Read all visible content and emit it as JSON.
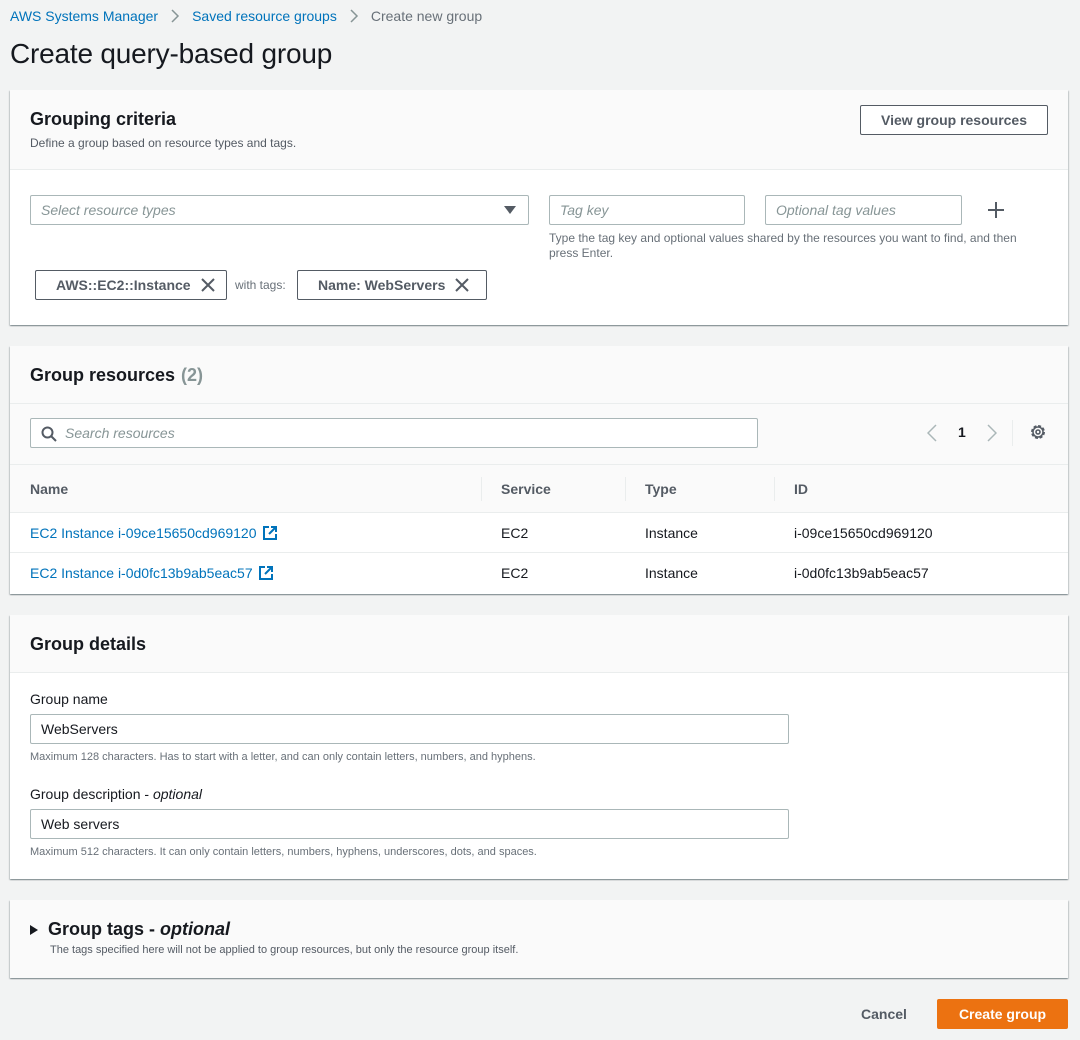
{
  "breadcrumb": {
    "items": [
      {
        "label": "AWS Systems Manager"
      },
      {
        "label": "Saved resource groups"
      },
      {
        "label": "Create new group"
      }
    ]
  },
  "page": {
    "title": "Create query-based group"
  },
  "grouping_criteria": {
    "title": "Grouping criteria",
    "description": "Define a group based on resource types and tags.",
    "view_button": "View group resources",
    "resource_types_placeholder": "Select resource types",
    "tag_key_placeholder": "Tag key",
    "tag_values_placeholder": "Optional tag values",
    "tag_hint": "Type the tag key and optional values shared by the resources you want to find, and then press Enter.",
    "resource_token": "AWS::EC2::Instance",
    "with_tags_label": "with tags:",
    "tag_token": "Name: WebServers"
  },
  "group_resources": {
    "title": "Group resources",
    "count": "(2)",
    "search_placeholder": "Search resources",
    "pagination": {
      "current_page": "1"
    },
    "columns": [
      "Name",
      "Service",
      "Type",
      "ID"
    ],
    "rows": [
      {
        "name": "EC2 Instance i-09ce15650cd969120",
        "service": "EC2",
        "type": "Instance",
        "id": "i-09ce15650cd969120"
      },
      {
        "name": "EC2 Instance i-0d0fc13b9ab5eac57",
        "service": "EC2",
        "type": "Instance",
        "id": "i-0d0fc13b9ab5eac57"
      }
    ]
  },
  "group_details": {
    "title": "Group details",
    "name_label": "Group name",
    "name_value": "WebServers",
    "name_hint": "Maximum 128 characters. Has to start with a letter, and can only contain letters, numbers, and hyphens.",
    "description_label": "Group description",
    "description_optional": "optional",
    "description_value": "Web servers",
    "description_hint": "Maximum 512 characters. It can only contain letters, numbers, hyphens, underscores, dots, and spaces."
  },
  "group_tags": {
    "title": "Group tags",
    "optional": "optional",
    "description": "The tags specified here will not be applied to group resources, but only the resource group itself."
  },
  "footer": {
    "cancel_label": "Cancel",
    "create_label": "Create group"
  },
  "colors": {
    "link": "#0073bb",
    "primary": "#ec7211",
    "background": "#f2f3f3"
  }
}
